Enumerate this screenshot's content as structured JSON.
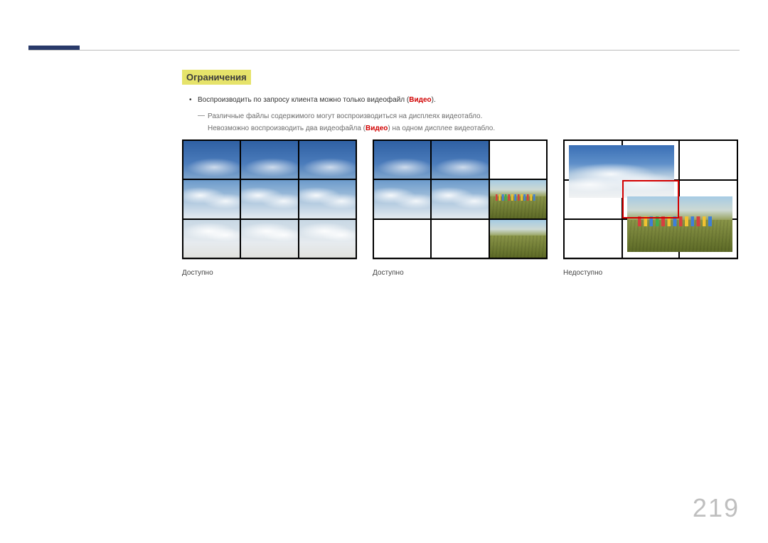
{
  "heading": "Ограничения",
  "bullet_pre": "Воспроизводить по запросу клиента можно только видеофайл (",
  "bullet_video": "Видео",
  "bullet_post": ").",
  "note_line1": "Различные файлы содержимого могут воспроизводиться на дисплеях видеотабло.",
  "note_line2_a": "Невозможно воспроизводить два видеофайла (",
  "note_line2_b": "Видео",
  "note_line2_c": ") на одном дисплее видеотабло.",
  "caption_available": "Доступно",
  "caption_unavailable": "Недоступно",
  "page_number": "219"
}
